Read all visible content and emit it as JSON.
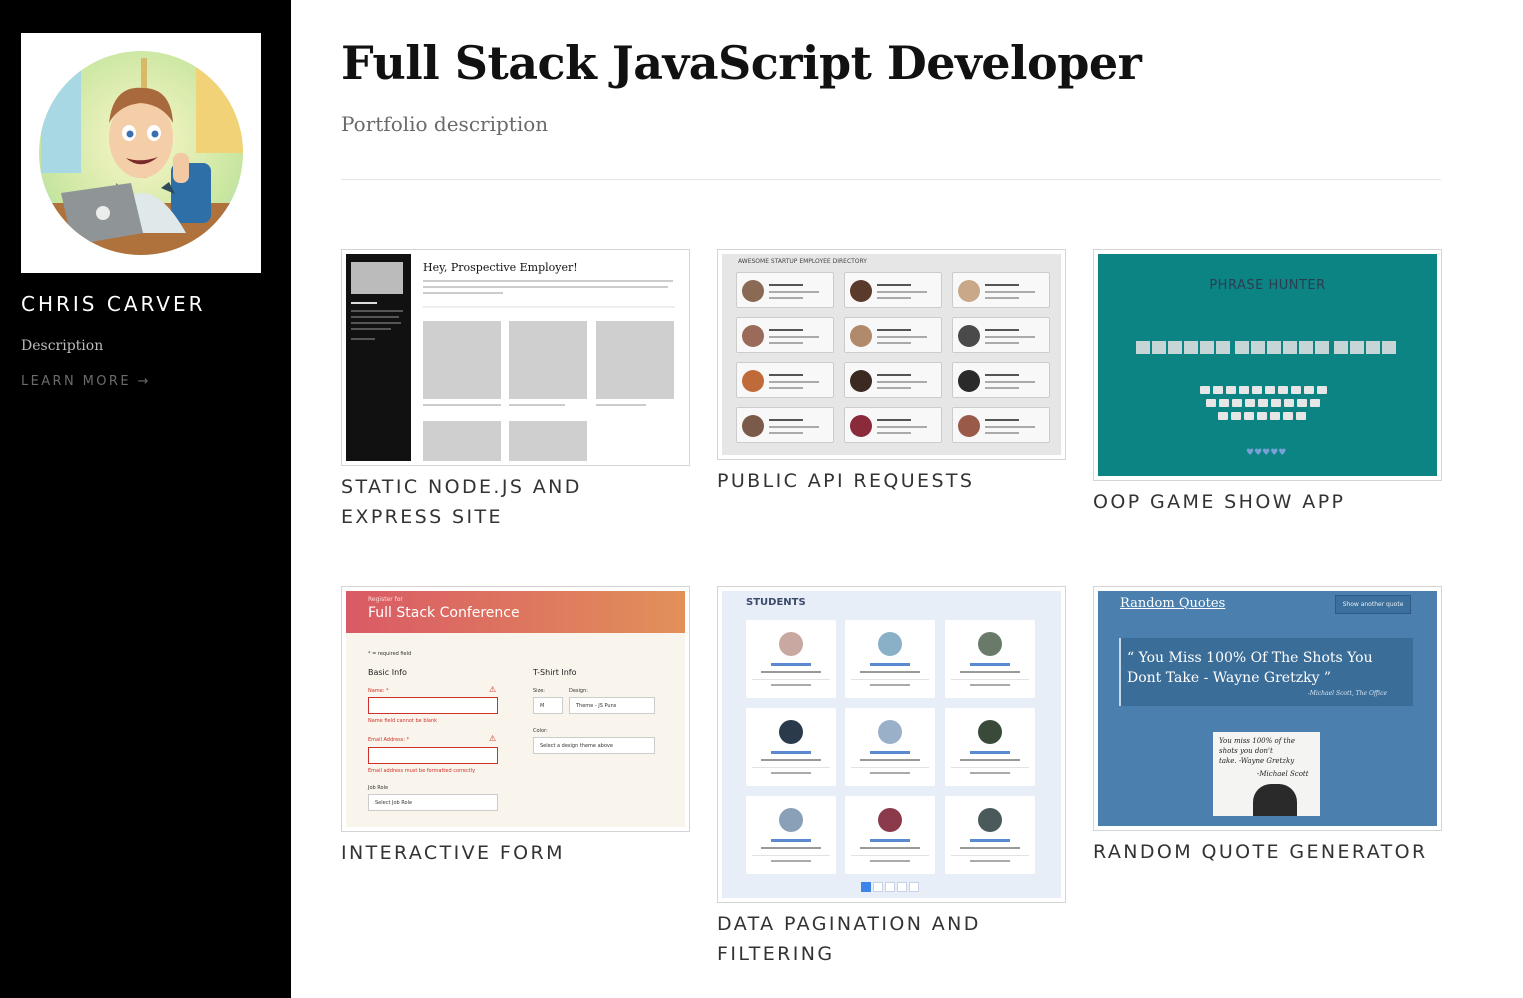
{
  "sidebar": {
    "avatar_alt": "avatar",
    "name": "CHRIS CARVER",
    "description": "Description",
    "learn_more": "LEARN MORE",
    "learn_more_arrow": "→"
  },
  "header": {
    "title": "Full Stack JavaScript Developer",
    "description": "Portfolio description"
  },
  "projects": [
    {
      "title": "STATIC NODE.JS AND EXPRESS SITE",
      "preview": {
        "heading": "Hey, Prospective Employer!"
      }
    },
    {
      "title": "PUBLIC API REQUESTS",
      "preview": {
        "heading": "AWESOME STARTUP EMPLOYEE DIRECTORY"
      }
    },
    {
      "title": "OOP GAME SHOW APP",
      "preview": {
        "heading": "PHRASE HUNTER",
        "hearts": "♥♥♥♥♥"
      }
    },
    {
      "title": "INTERACTIVE FORM",
      "preview": {
        "banner_small": "Register for",
        "banner_title": "Full Stack Conference",
        "required_note": "* = required field",
        "basic_info": "Basic Info",
        "tshirt_info": "T-Shirt Info",
        "name_label": "Name: *",
        "name_error": "Name field cannot be blank",
        "email_label": "Email Address: *",
        "email_error": "Email address must be formatted correctly",
        "job_role_label": "Job Role",
        "job_role_value": "Select Job Role",
        "size_label": "Size:",
        "size_value": "M",
        "design_label": "Design:",
        "design_value": "Theme - JS Puns",
        "color_label": "Color:",
        "color_value": "Select a design theme above"
      }
    },
    {
      "title": "DATA PAGINATION AND FILTERING",
      "preview": {
        "heading": "STUDENTS"
      }
    },
    {
      "title": "RANDOM QUOTE GENERATOR",
      "preview": {
        "heading": "Random Quotes",
        "button": "Show another quote",
        "quote": "“ You Miss 100% Of The Shots You Dont Take - Wayne Gretzky ”",
        "attribution": "-Michael Scott, The Office",
        "photo_line1": "You miss 100% of the",
        "photo_line2": "shots you don't",
        "photo_line3": "take. -Wayne Gretzky",
        "photo_line4": "-Michael Scott"
      }
    }
  ],
  "colors": {
    "sidebar_bg": "#000000",
    "game_bg": "#0d8484",
    "quote_bg": "#4a7fae",
    "form_banner_start": "#d95a65",
    "form_banner_end": "#e2905a"
  }
}
